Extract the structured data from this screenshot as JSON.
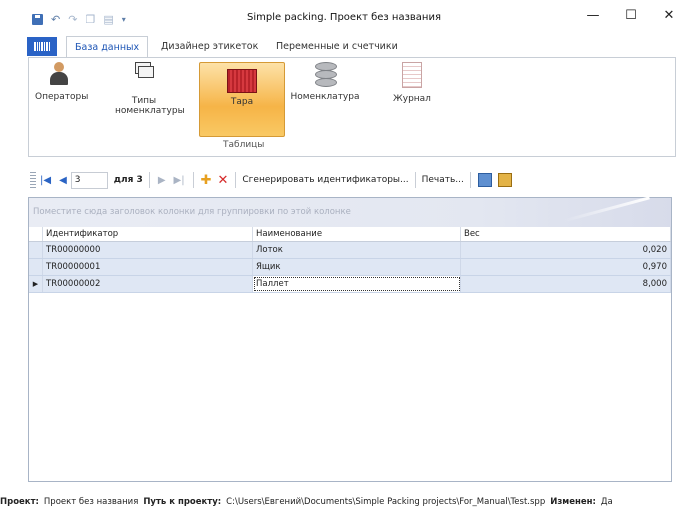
{
  "window": {
    "title": "Simple packing. Проект без названия",
    "controls": {
      "minimize": "—",
      "maximize": "☐",
      "close": "✕"
    }
  },
  "ribbon": {
    "tabs": [
      {
        "label": "База данных",
        "active": true
      },
      {
        "label": "Дизайнер этикеток",
        "active": false
      },
      {
        "label": "Переменные и счетчики",
        "active": false
      }
    ],
    "buttons": {
      "operators": "Операторы",
      "nomenclature_types_line1": "Типы",
      "nomenclature_types_line2": "номенклатуры",
      "tara": "Тара",
      "nomenclature": "Номенклатура",
      "journal": "Журнал"
    },
    "group_label": "Таблицы"
  },
  "navigator": {
    "position": "3",
    "of_text": "для 3",
    "generate_ids": "Сгенерировать идентификаторы...",
    "print": "Печать..."
  },
  "grid": {
    "group_hint": "Поместите сюда заголовок колонки для группировки по этой колонке",
    "columns": [
      "Идентификатор",
      "Наименование",
      "Вес"
    ],
    "rows": [
      {
        "id": "TR00000000",
        "name": "Лоток",
        "weight": "0,020"
      },
      {
        "id": "TR00000001",
        "name": "Ящик",
        "weight": "0,970"
      },
      {
        "id": "TR00000002",
        "name": "Паллет",
        "weight": "8,000",
        "current": true
      }
    ],
    "current_row_marker": "▶"
  },
  "status": {
    "project_label": "Проект:",
    "project_value": "Проект без названия",
    "path_label": "Путь к проекту:",
    "path_value": "C:\\Users\\Евгений\\Documents\\Simple Packing projects\\For_Manual\\Test.spp",
    "changed_label": "Изменен:",
    "changed_value": "Да"
  },
  "colors": {
    "accent": "#2a63c6",
    "selected_button": "#f6b447",
    "row_bg": "#dfe7f4"
  }
}
